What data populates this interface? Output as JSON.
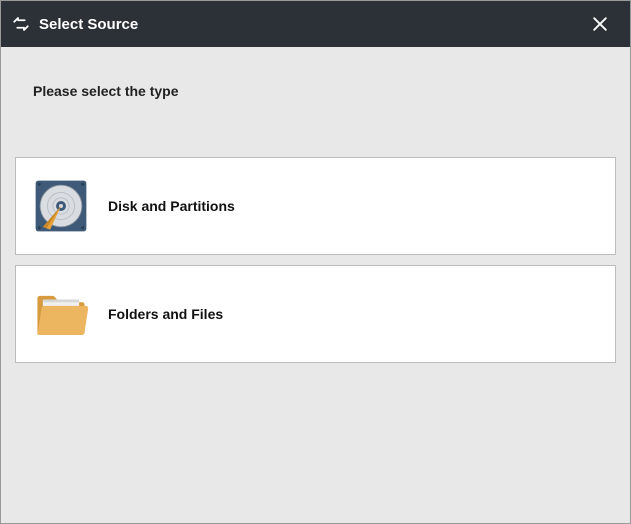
{
  "header": {
    "title": "Select Source"
  },
  "main": {
    "prompt": "Please select the type",
    "options": [
      {
        "label": "Disk and Partitions",
        "icon": "disk-icon"
      },
      {
        "label": "Folders and Files",
        "icon": "folder-icon"
      }
    ]
  }
}
